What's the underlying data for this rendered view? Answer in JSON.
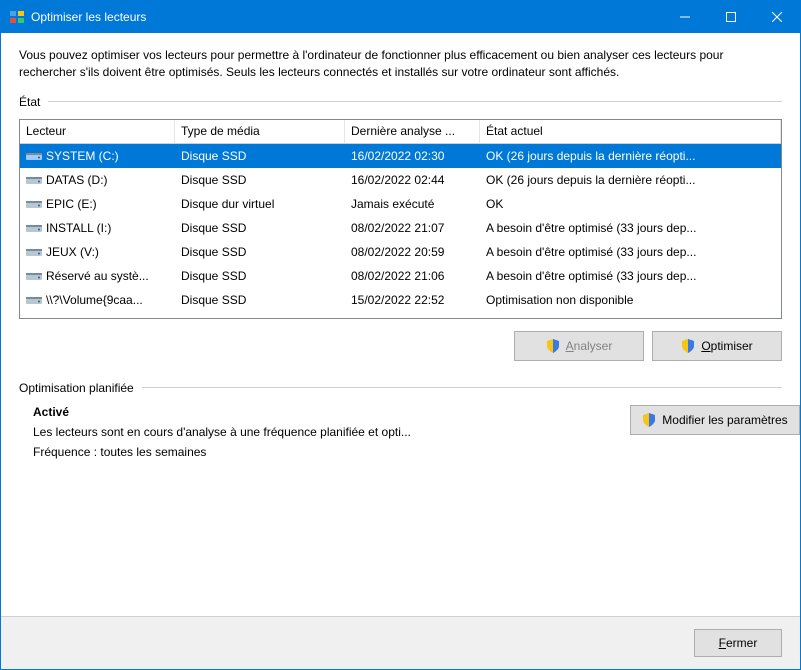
{
  "window": {
    "title": "Optimiser les lecteurs"
  },
  "intro": "Vous pouvez optimiser vos lecteurs pour permettre à l'ordinateur de fonctionner plus efficacement ou bien analyser ces lecteurs pour rechercher s'ils doivent être optimisés. Seuls les lecteurs connectés et installés sur votre ordinateur sont affichés.",
  "status_section_label": "État",
  "columns": {
    "drive": "Lecteur",
    "media": "Type de média",
    "last": "Dernière analyse ...",
    "status": "État actuel"
  },
  "drives": [
    {
      "name": "SYSTEM (C:)",
      "media": "Disque SSD",
      "last": "16/02/2022 02:30",
      "status": "OK (26 jours depuis la dernière réopti...",
      "icon": "drive",
      "selected": true
    },
    {
      "name": "DATAS (D:)",
      "media": "Disque SSD",
      "last": "16/02/2022 02:44",
      "status": "OK (26 jours depuis la dernière réopti...",
      "icon": "drive"
    },
    {
      "name": "EPIC (E:)",
      "media": "Disque dur virtuel",
      "last": "Jamais exécuté",
      "status": "OK",
      "icon": "drive"
    },
    {
      "name": "INSTALL (I:)",
      "media": "Disque SSD",
      "last": "08/02/2022 21:07",
      "status": "A besoin d'être optimisé (33 jours dep...",
      "icon": "drive"
    },
    {
      "name": "JEUX (V:)",
      "media": "Disque SSD",
      "last": "08/02/2022 20:59",
      "status": "A besoin d'être optimisé (33 jours dep...",
      "icon": "drive"
    },
    {
      "name": "Réservé au systè...",
      "media": "Disque SSD",
      "last": "08/02/2022 21:06",
      "status": "A besoin d'être optimisé (33 jours dep...",
      "icon": "drive"
    },
    {
      "name": "\\\\?\\Volume{9caa...",
      "media": "Disque SSD",
      "last": "15/02/2022 22:52",
      "status": "Optimisation non disponible",
      "icon": "drive"
    }
  ],
  "buttons": {
    "analyze": "Analyser",
    "analyze_accel": "A",
    "optimize": "Optimiser",
    "optimize_accel": "O",
    "change_settings": "Modifier les paramètres",
    "change_accel": "M",
    "close": "Fermer",
    "close_accel": "F"
  },
  "schedule": {
    "section_label": "Optimisation planifiée",
    "title": "Activé",
    "line1": "Les lecteurs sont en cours d'analyse à une fréquence planifiée et opti...",
    "line2": "Fréquence : toutes les semaines"
  }
}
